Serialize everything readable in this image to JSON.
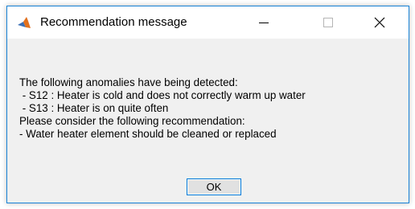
{
  "window": {
    "title": "Recommendation message",
    "app_icon": "matlab-icon",
    "controls": {
      "minimize_icon": "minimize-icon",
      "maximize_icon": "maximize-icon",
      "close_icon": "close-icon"
    },
    "accent_color": "#1883d7"
  },
  "message": {
    "lines": [
      "The following anomalies have being detected:",
      " - S12 : Heater is cold and does not correctly warm up water",
      " - S13 : Heater is on quite often",
      "Please consider the following recommendation:",
      "- Water heater element should be cleaned or replaced"
    ]
  },
  "buttons": {
    "ok_label": "OK"
  }
}
